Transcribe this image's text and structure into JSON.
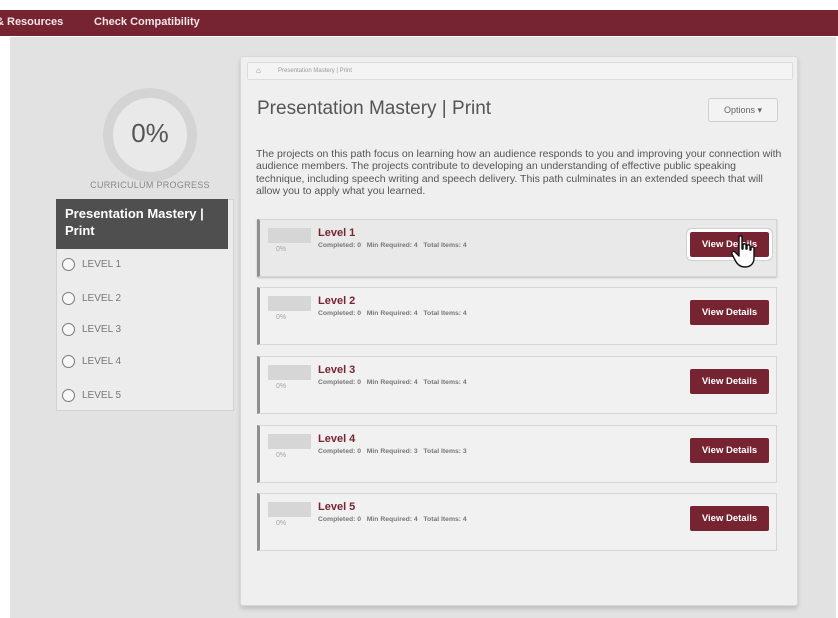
{
  "nav": {
    "items": [
      "& Resources",
      "Check Compatibility"
    ]
  },
  "progress": {
    "percent_label": "0%",
    "caption": "CURRICULUM PROGRESS"
  },
  "sidebar": {
    "title": "Presentation Mastery | Print",
    "levels": [
      "LEVEL 1",
      "LEVEL 2",
      "LEVEL 3",
      "LEVEL 4",
      "LEVEL 5"
    ]
  },
  "breadcrumb": {
    "text": "Presentation Mastery | Print"
  },
  "main": {
    "title": "Presentation Mastery | Print",
    "options_label": "Options",
    "description": "The projects on this path focus on learning how an audience responds to you and improving your connection with audience members. The projects contribute to developing an understanding of effective public speaking technique, including speech writing and speech delivery. This path culminates in an extended speech that will allow you to apply what you learned."
  },
  "levels": [
    {
      "name": "Level 1",
      "pct": "0%",
      "completed": "Completed: 0",
      "min_required": "Min Required: 4",
      "total_items": "Total Items: 4",
      "button": "View Details"
    },
    {
      "name": "Level 2",
      "pct": "0%",
      "completed": "Completed: 0",
      "min_required": "Min Required: 4",
      "total_items": "Total Items: 4",
      "button": "View Details"
    },
    {
      "name": "Level 3",
      "pct": "0%",
      "completed": "Completed: 0",
      "min_required": "Min Required: 4",
      "total_items": "Total Items: 4",
      "button": "View Details"
    },
    {
      "name": "Level 4",
      "pct": "0%",
      "completed": "Completed: 0",
      "min_required": "Min Required: 3",
      "total_items": "Total Items: 3",
      "button": "View Details"
    },
    {
      "name": "Level 5",
      "pct": "0%",
      "completed": "Completed: 0",
      "min_required": "Min Required: 4",
      "total_items": "Total Items: 4",
      "button": "View Details"
    }
  ],
  "colors": {
    "brand": "#772432",
    "sidebar_title_bg": "#4f4f4f",
    "canvas_bg": "#e2e2e2"
  }
}
